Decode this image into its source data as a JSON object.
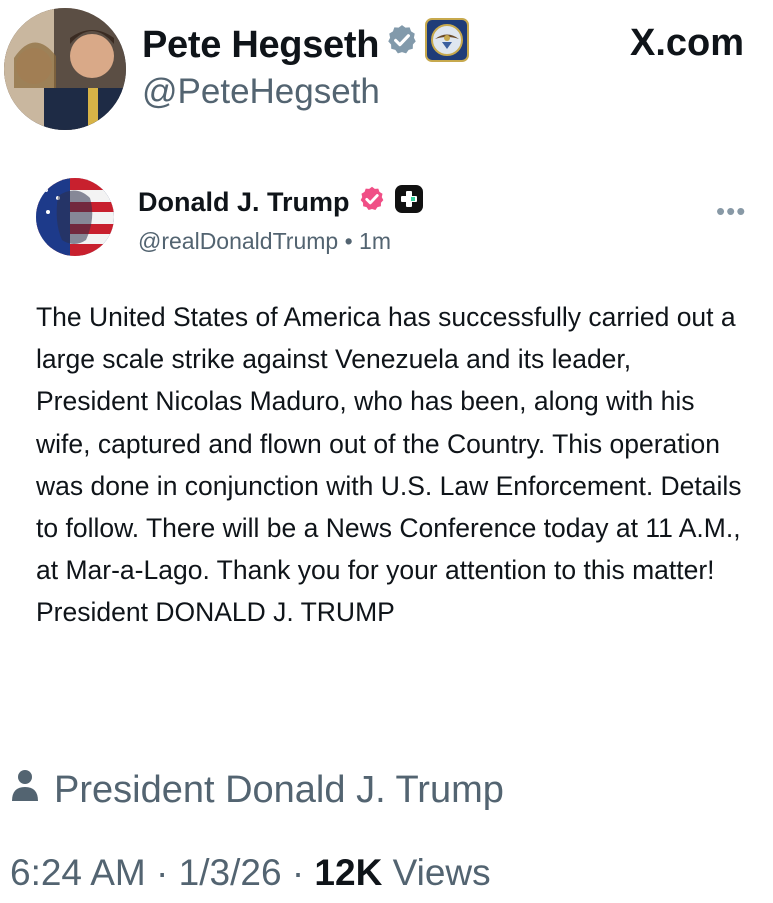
{
  "outer_post": {
    "author_name": "Pete Hegseth",
    "author_handle": "@PeteHegseth",
    "site_label": "X.com"
  },
  "embedded_post": {
    "author_name": "Donald J. Trump",
    "author_handle": "@realDonaldTrump",
    "separator": "•",
    "time_ago": "1m",
    "more_label": "•••",
    "body": "The United States of America has successfully carried out a large scale strike against Venezuela and its leader, President Nicolas Maduro, who has been, along with his wife, captured and flown out of the Country. This operation was done in conjunction with U.S. Law Enforcement. Details to follow. There will be a News Conference today at 11 A.M., at Mar-a-Lago. Thank you for your attention to this matter! President DONALD J. TRUMP"
  },
  "attribution": {
    "text": "President Donald J. Trump"
  },
  "footer": {
    "time": "6:24 AM",
    "dot1": "·",
    "date": "1/3/26",
    "dot2": "·",
    "views_count": "12K",
    "views_label": "Views"
  },
  "colors": {
    "verified_gray": "#829aab",
    "verified_pink": "#f04f86",
    "secondary_text": "#536471",
    "primary_text": "#0f1419"
  }
}
